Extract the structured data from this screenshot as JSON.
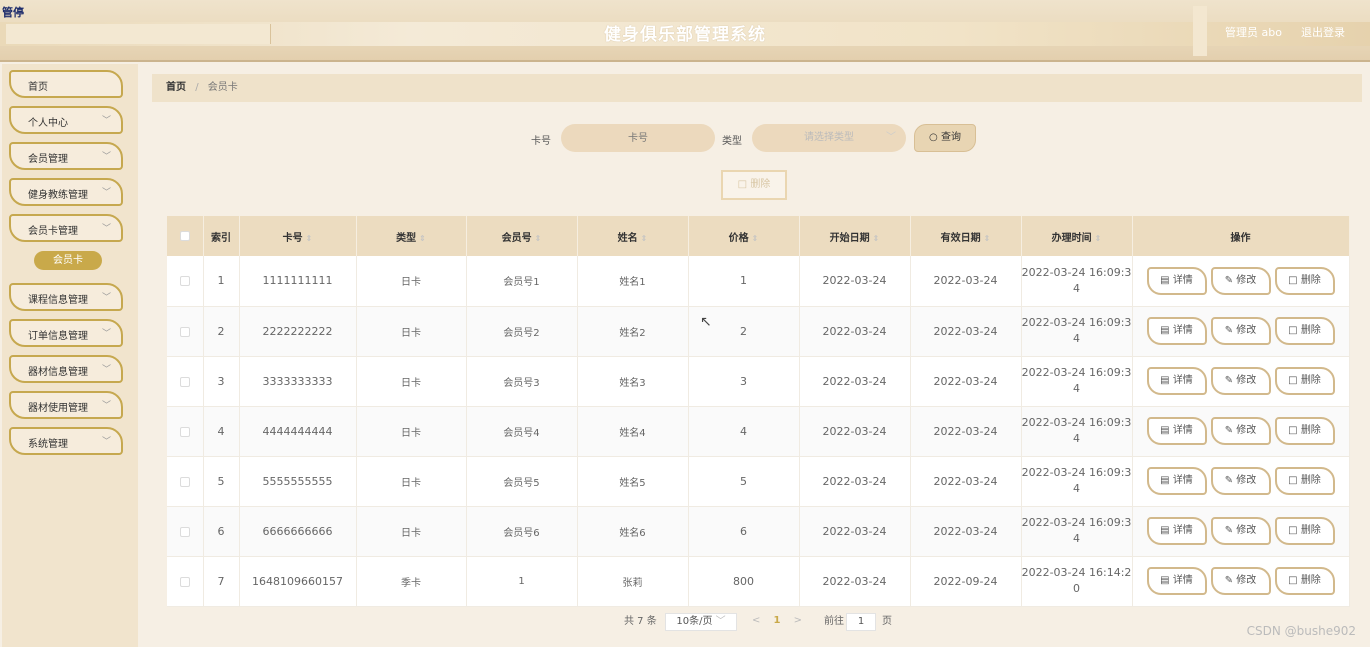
{
  "header": {
    "tag": "管停",
    "title": "健身俱乐部管理系统",
    "user": "管理员 abo",
    "logout": "退出登录"
  },
  "sidebar": {
    "items": [
      {
        "label": "首页",
        "has_chevron": false
      },
      {
        "label": "个人中心",
        "has_chevron": true
      },
      {
        "label": "会员管理",
        "has_chevron": true
      },
      {
        "label": "健身教练管理",
        "has_chevron": true
      },
      {
        "label": "会员卡管理",
        "has_chevron": true
      },
      {
        "label": "课程信息管理",
        "has_chevron": true
      },
      {
        "label": "订单信息管理",
        "has_chevron": true
      },
      {
        "label": "器材信息管理",
        "has_chevron": true
      },
      {
        "label": "器材使用管理",
        "has_chevron": true
      },
      {
        "label": "系统管理",
        "has_chevron": true
      }
    ],
    "submenu_active": "会员卡",
    "chevron": "﹀"
  },
  "breadcrumb": {
    "home": "首页",
    "sep": "/",
    "current": "会员卡"
  },
  "search": {
    "card_label": "卡号",
    "card_placeholder": "卡号",
    "type_label": "类型",
    "type_placeholder": "请选择类型",
    "query_label": "查询",
    "delete_label": "删除"
  },
  "table": {
    "headers": {
      "index": "索引",
      "card_no": "卡号",
      "type": "类型",
      "member_no": "会员号",
      "name": "姓名",
      "price": "价格",
      "start_date": "开始日期",
      "valid_date": "有效日期",
      "handle_time": "办理时间",
      "ops": "操作"
    },
    "rows": [
      {
        "index": "1",
        "card_no": "1111111111",
        "type": "日卡",
        "member_no": "会员号1",
        "name": "姓名1",
        "price": "1",
        "start_date": "2022-03-24",
        "valid_date": "2022-03-24",
        "time_a": "2022-03-24 16:09:3",
        "time_b": "4"
      },
      {
        "index": "2",
        "card_no": "2222222222",
        "type": "日卡",
        "member_no": "会员号2",
        "name": "姓名2",
        "price": "2",
        "start_date": "2022-03-24",
        "valid_date": "2022-03-24",
        "time_a": "2022-03-24 16:09:3",
        "time_b": "4"
      },
      {
        "index": "3",
        "card_no": "3333333333",
        "type": "日卡",
        "member_no": "会员号3",
        "name": "姓名3",
        "price": "3",
        "start_date": "2022-03-24",
        "valid_date": "2022-03-24",
        "time_a": "2022-03-24 16:09:3",
        "time_b": "4"
      },
      {
        "index": "4",
        "card_no": "4444444444",
        "type": "日卡",
        "member_no": "会员号4",
        "name": "姓名4",
        "price": "4",
        "start_date": "2022-03-24",
        "valid_date": "2022-03-24",
        "time_a": "2022-03-24 16:09:3",
        "time_b": "4"
      },
      {
        "index": "5",
        "card_no": "5555555555",
        "type": "日卡",
        "member_no": "会员号5",
        "name": "姓名5",
        "price": "5",
        "start_date": "2022-03-24",
        "valid_date": "2022-03-24",
        "time_a": "2022-03-24 16:09:3",
        "time_b": "4"
      },
      {
        "index": "6",
        "card_no": "6666666666",
        "type": "日卡",
        "member_no": "会员号6",
        "name": "姓名6",
        "price": "6",
        "start_date": "2022-03-24",
        "valid_date": "2022-03-24",
        "time_a": "2022-03-24 16:09:3",
        "time_b": "4"
      },
      {
        "index": "7",
        "card_no": "1648109660157",
        "type": "季卡",
        "member_no": "1",
        "name": "张莉",
        "price": "800",
        "start_date": "2022-03-24",
        "valid_date": "2022-09-24",
        "time_a": "2022-03-24 16:14:2",
        "time_b": "0"
      }
    ],
    "row_actions": {
      "detail": "详情",
      "edit": "修改",
      "delete": "删除"
    }
  },
  "pagination": {
    "total": "共 7 条",
    "page_size": "10条/页",
    "current_page": "1",
    "goto_label": "前往",
    "goto_value": "1",
    "page_suffix": "页"
  },
  "watermark": "CSDN @bushe902",
  "colors": {
    "accent": "#c9a94a",
    "header_bg": "#e9d9bb",
    "table_header_bg": "#ecdcc0",
    "button_border": "#d2b98c"
  },
  "icons": {
    "detail": "doc-icon",
    "edit": "pencil-icon",
    "delete": "trash-icon",
    "query": "search-icon"
  }
}
